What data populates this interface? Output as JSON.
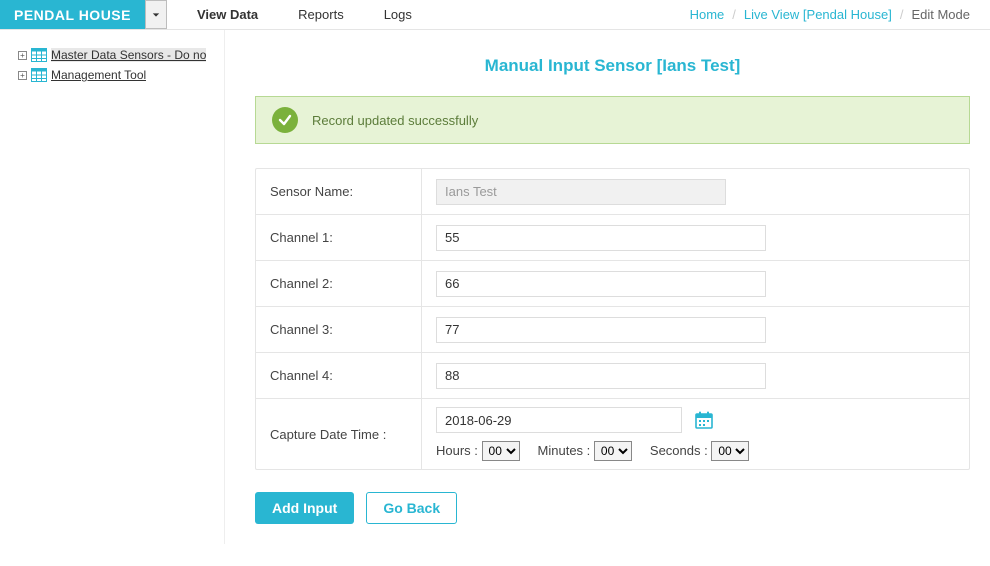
{
  "brand": "PENDAL HOUSE",
  "nav": {
    "viewData": "View Data",
    "reports": "Reports",
    "logs": "Logs"
  },
  "breadcrumbs": {
    "home": "Home",
    "liveView": "Live View [Pendal House]",
    "current": "Edit Mode",
    "sep": "/"
  },
  "tree": {
    "items": [
      {
        "label": "Master Data Sensors - Do no"
      },
      {
        "label": "Management Tool"
      }
    ]
  },
  "page": {
    "title": "Manual Input Sensor [Ians Test]",
    "alert": "Record updated successfully"
  },
  "form": {
    "sensorName": {
      "label": "Sensor Name:",
      "value": "Ians Test"
    },
    "channel1": {
      "label": "Channel 1:",
      "value": "55"
    },
    "channel2": {
      "label": "Channel 2:",
      "value": "66"
    },
    "channel3": {
      "label": "Channel 3:",
      "value": "77"
    },
    "channel4": {
      "label": "Channel 4:",
      "value": "88"
    },
    "captureDateTime": {
      "label": "Capture Date Time :",
      "date": "2018-06-29",
      "hoursLabel": "Hours :",
      "hours": "00",
      "minutesLabel": "Minutes :",
      "minutes": "00",
      "secondsLabel": "Seconds :",
      "seconds": "00"
    }
  },
  "buttons": {
    "addInput": "Add Input",
    "goBack": "Go Back"
  }
}
